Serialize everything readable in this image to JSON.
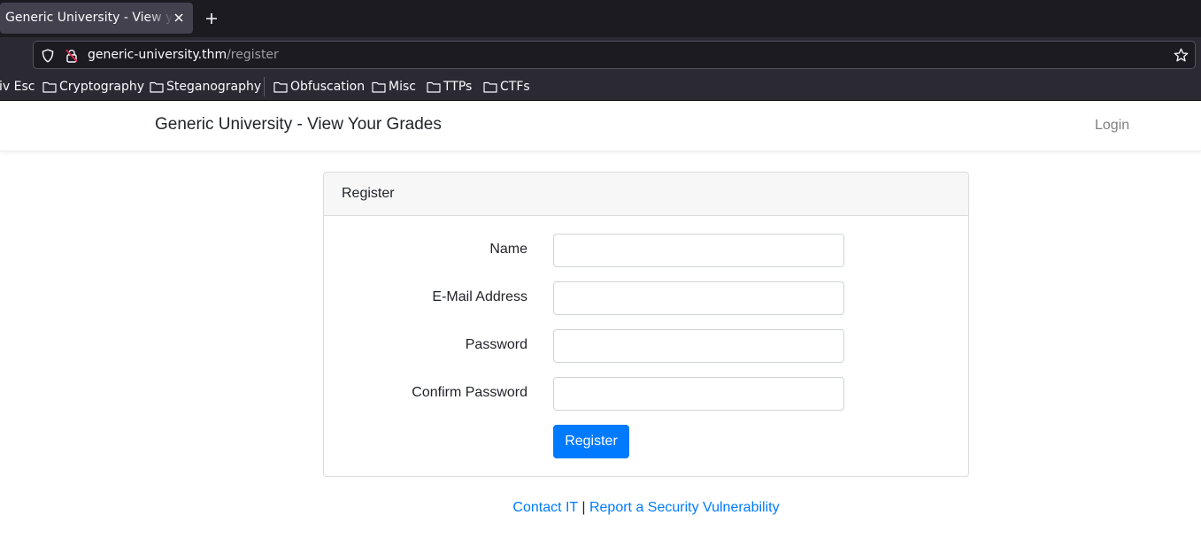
{
  "browser": {
    "tab_title": "Generic University - View your Grades",
    "url_host": "generic-university.thm",
    "url_path": "/register",
    "bookmarks": [
      {
        "label": "iv Esc",
        "folder": false
      },
      {
        "label": "Cryptography",
        "folder": true
      },
      {
        "label": "Steganography",
        "folder": true
      },
      {
        "label": "Obfuscation",
        "folder": true
      },
      {
        "label": "Misc",
        "folder": true
      },
      {
        "label": "TTPs",
        "folder": true
      },
      {
        "label": "CTFs",
        "folder": true
      }
    ]
  },
  "site": {
    "brand": "Generic University - View Your Grades",
    "login": "Login"
  },
  "form": {
    "title": "Register",
    "fields": [
      {
        "label": "Name",
        "value": ""
      },
      {
        "label": "E-Mail Address",
        "value": ""
      },
      {
        "label": "Password",
        "value": ""
      },
      {
        "label": "Confirm Password",
        "value": ""
      }
    ],
    "submit": "Register"
  },
  "footer": {
    "contact": "Contact IT",
    "separator": "|",
    "report": "Report a Security Vulnerability"
  },
  "colors": {
    "primary": "#007bff",
    "browser_dark": "#1c1b22",
    "toolbar": "#2b2a33"
  }
}
